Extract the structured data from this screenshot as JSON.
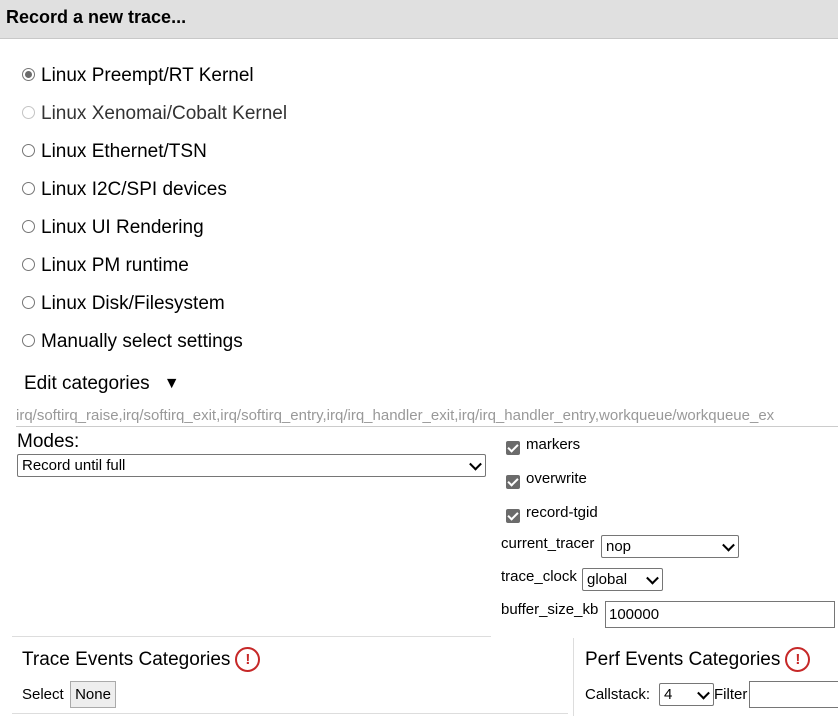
{
  "header": {
    "title": "Record a new trace..."
  },
  "presets": [
    {
      "label": "Linux Preempt/RT Kernel",
      "checked": true,
      "disabled": false
    },
    {
      "label": "Linux Xenomai/Cobalt Kernel",
      "checked": false,
      "disabled": true
    },
    {
      "label": "Linux Ethernet/TSN",
      "checked": false,
      "disabled": false
    },
    {
      "label": "Linux I2C/SPI devices",
      "checked": false,
      "disabled": false
    },
    {
      "label": "Linux UI Rendering",
      "checked": false,
      "disabled": false
    },
    {
      "label": "Linux PM runtime",
      "checked": false,
      "disabled": false
    },
    {
      "label": "Linux Disk/Filesystem",
      "checked": false,
      "disabled": false
    },
    {
      "label": "Manually select settings",
      "checked": false,
      "disabled": false
    }
  ],
  "edit_categories": {
    "label": "Edit categories",
    "arrow": "▼"
  },
  "categories_value": "irq/softirq_raise,irq/softirq_exit,irq/softirq_entry,irq/irq_handler_exit,irq/irq_handler_entry,workqueue/workqueue_ex",
  "modes": {
    "label": "Modes:",
    "selected": "Record until full"
  },
  "options": {
    "markers": "markers",
    "overwrite": "overwrite",
    "record_tgid": "record-tgid",
    "current_tracer_label": "current_tracer",
    "current_tracer_value": "nop",
    "trace_clock_label": "trace_clock",
    "trace_clock_value": "global",
    "buffer_size_label": "buffer_size_kb",
    "buffer_size_value": "100000"
  },
  "trace_events": {
    "title": "Trace Events Categories",
    "select_label": "Select",
    "none_button": "None",
    "warn_icon": "!"
  },
  "perf_events": {
    "title": "Perf Events Categories",
    "callstack_label": "Callstack:",
    "callstack_value": "4",
    "filter_label": "Filter",
    "warn_icon": "!"
  }
}
